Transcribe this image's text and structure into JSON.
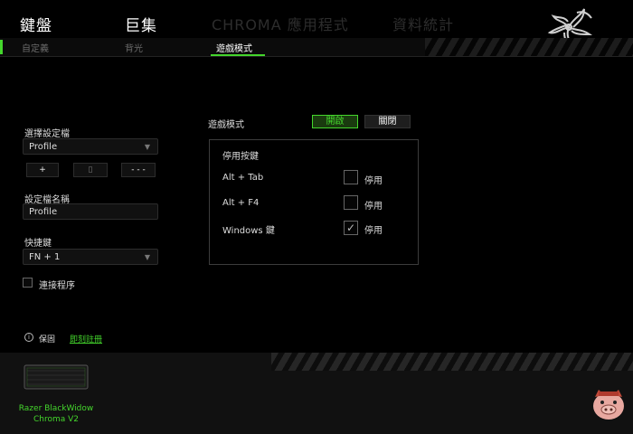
{
  "nav": {
    "items": [
      {
        "label": "鍵盤"
      },
      {
        "label": "巨集"
      },
      {
        "label": "CHROMA 應用程式"
      },
      {
        "label": "資料統計"
      }
    ]
  },
  "subnav": {
    "items": [
      {
        "label": "自定義"
      },
      {
        "label": "背光"
      },
      {
        "label": "遊戲模式"
      }
    ]
  },
  "profile": {
    "select_label": "選擇設定檔",
    "selected": "Profile",
    "add_label": "+",
    "copy_label": "▯",
    "more_label": "- - -",
    "name_label": "設定檔名稱",
    "name_value": "Profile",
    "shortcut_label": "快捷鍵",
    "shortcut_value": "FN + 1",
    "link_label": "連接程序"
  },
  "footer": {
    "save_label": "保固",
    "register_label": "即刻註冊"
  },
  "gamemode": {
    "label": "遊戲模式",
    "on_label": "開啟",
    "off_label": "關閉",
    "group_title": "停用按鍵",
    "rows": [
      {
        "label": "Alt + Tab",
        "checkbox_label": "停用",
        "checked": false
      },
      {
        "label": "Alt + F4",
        "checkbox_label": "停用",
        "checked": false
      },
      {
        "label": "Windows 鍵",
        "checkbox_label": "停用",
        "checked": true
      }
    ]
  },
  "device": {
    "name_line1": "Razer BlackWidow",
    "name_line2": "Chroma V2"
  },
  "colors": {
    "accent": "#44d62c",
    "background": "#000000"
  }
}
